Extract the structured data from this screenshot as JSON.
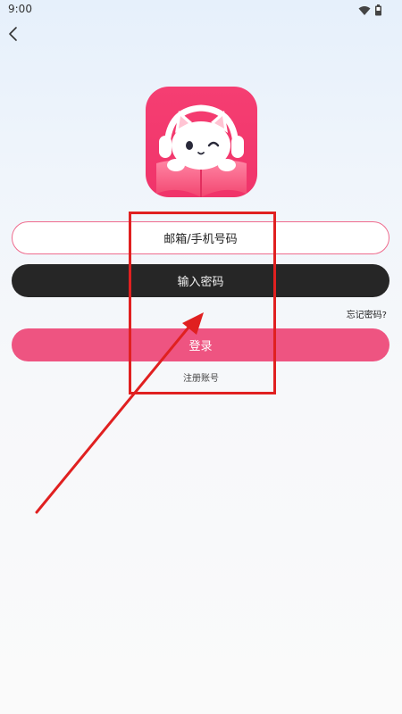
{
  "status_bar": {
    "time": "9:00",
    "wifi_icon": "wifi-icon",
    "battery_icon": "battery-icon"
  },
  "nav": {
    "back_icon": "chevron-left-icon"
  },
  "logo": {
    "icon": "cat-headphones-book-logo",
    "bg_color": "#f43f72",
    "accent_color": "#ffffff"
  },
  "form": {
    "email_placeholder": "邮箱/手机号码",
    "password_placeholder": "输入密码",
    "forgot_password": "忘记密码?",
    "login_label": "登录",
    "register_label": "注册账号"
  },
  "colors": {
    "accent": "#ee5481",
    "dark_field": "#262626",
    "field_border": "#ef6b8d",
    "annotation": "#e02020"
  }
}
